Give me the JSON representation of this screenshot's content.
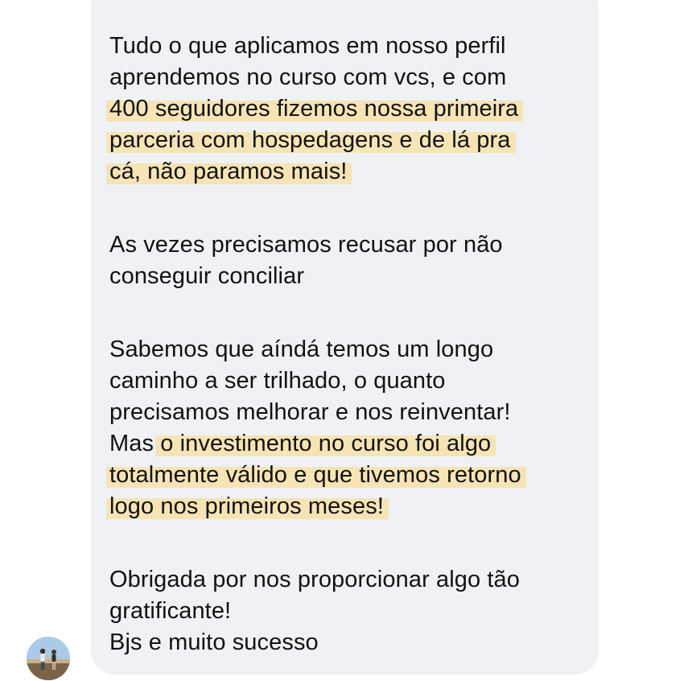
{
  "message": {
    "paragraph1": {
      "line1": "Tudo o que aplicamos em nosso perfil",
      "line2": "aprendemos no curso com vcs, e com",
      "line3": "400 seguidores fizemos nossa primeira",
      "line4": "parceria com hospedagens e de lá pra",
      "line5": "cá, não paramos mais!"
    },
    "paragraph2": {
      "line1": "As vezes precisamos recusar por não",
      "line2": "conseguir conciliar"
    },
    "paragraph3": {
      "line1": "Sabemos que aíndá temos um longo",
      "line2": "caminho a ser trilhado, o quanto",
      "line3": "precisamos melhorar e nos reinventar!",
      "line4_prefix": "Mas ",
      "line4_highlight": "o investimento no curso foi algo",
      "line5": "totalmente válido e que tivemos retorno",
      "line6": "logo nos primeiros meses! "
    },
    "paragraph4": {
      "line1": "Obrigada por nos proporcionar algo tão",
      "line2": "gratificante!",
      "line3": "Bjs e muito sucesso"
    }
  },
  "avatar": {
    "icon": "sender-avatar-photo"
  },
  "colors": {
    "bubble": "#eff1f4",
    "highlight": "#f7e4b5",
    "text": "#121212"
  }
}
